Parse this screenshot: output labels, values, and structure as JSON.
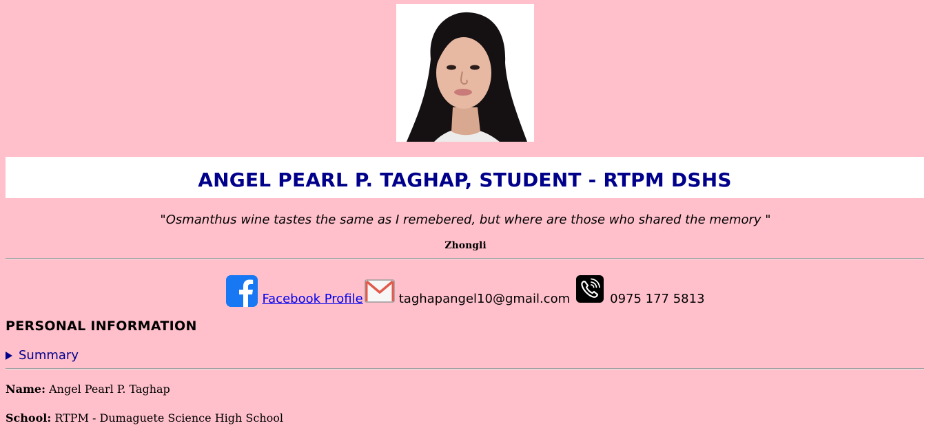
{
  "header": {
    "name_title": "ANGEL PEARL P. TAGHAP, STUDENT - RTPM DSHS"
  },
  "quote": {
    "text": "\"Osmanthus wine tastes the same as I remebered, but where are those who shared the memory \"",
    "author": "Zhongli"
  },
  "contacts": {
    "facebook_label": "Facebook Profile ",
    "email": "taghapangel10@gmail.com",
    "phone": "0975 177 5813"
  },
  "personal_info": {
    "heading": "PERSONAL INFORMATION",
    "summary_label": "Summary",
    "name_label": "Name:",
    "name_value": "Angel Pearl P. Taghap",
    "school_label": "School:",
    "school_value": "RTPM - Dumaguete Science High School"
  },
  "colors": {
    "background": "#ffc0cb",
    "title": "#00008b",
    "link": "#0000ee",
    "facebook": "#1877f2"
  }
}
